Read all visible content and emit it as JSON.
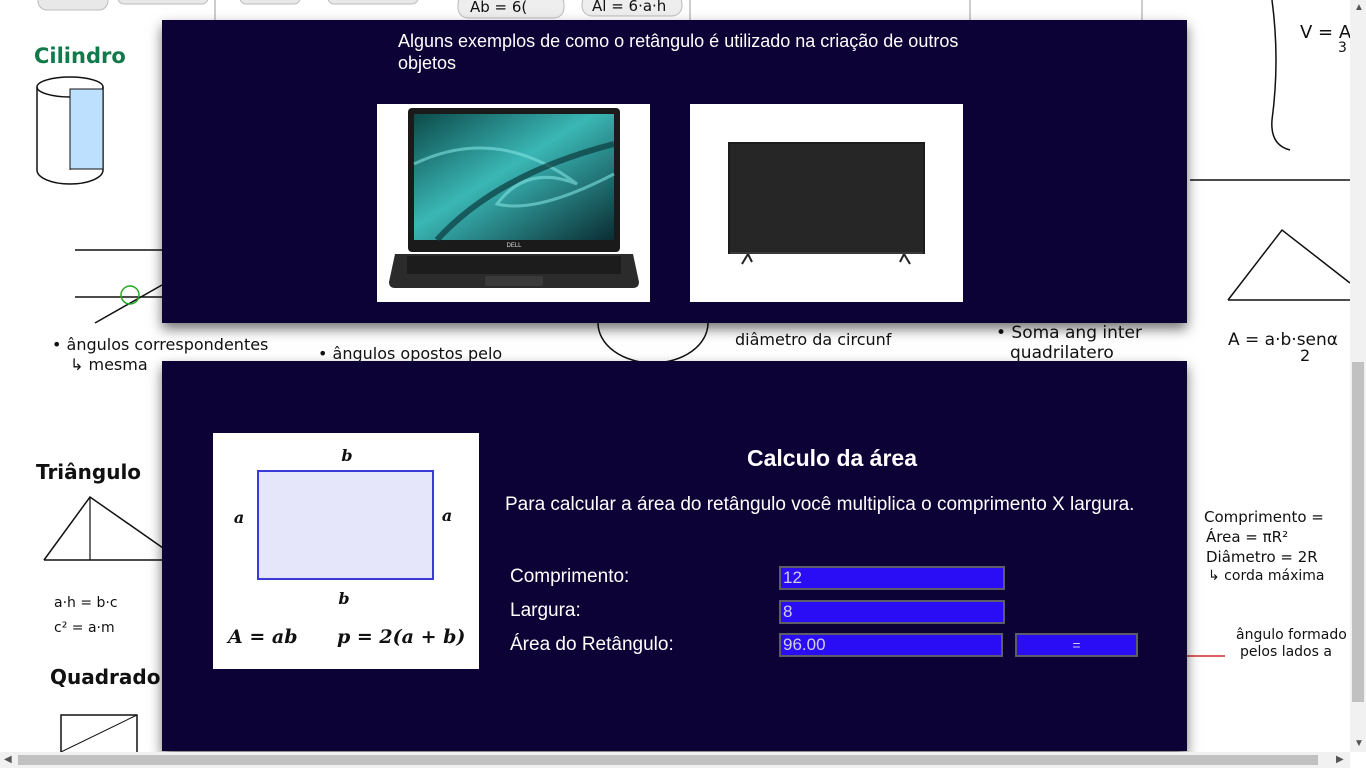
{
  "background": {
    "headings": {
      "cilindro": "Cilindro",
      "triangulo": "Triângulo",
      "quadrado": "Quadrado"
    },
    "notes": {
      "angulos_correspondentes": "• ângulos correspondentes",
      "mesma": "↳ mesma",
      "angulos_opostos": "• ângulos opostos pelo",
      "diametro": "diâmetro da circunf",
      "soma_ang": "• Soma ang inter",
      "quadrilatero": "quadrilatero",
      "area_triangulo": "A = a·b·senα",
      "area_triangulo_den": "2",
      "comprimento": "Comprimento =",
      "area_circ": "Área = πR²",
      "diametro_circ": "Diâmetro = 2R",
      "corda": "↳ corda máxima",
      "angulo_formado": "ângulo formado",
      "pelos_lados": "pelos lados a",
      "relacao_1": "a·h = b·c",
      "relacao_2": "c² = a·m",
      "ab_formula": "Ab = 6(",
      "al_formula": "Al = 6·a·h",
      "v_formula": "V = Ab",
      "v_den": "3"
    }
  },
  "examples_panel": {
    "caption": "Alguns exemplos de como o retângulo é utilizado na criação de outros objetos",
    "laptop_brand": "DELL"
  },
  "area_panel": {
    "figure": {
      "label_top": "b",
      "label_bottom": "b",
      "label_left": "a",
      "label_right": "a",
      "formula_area": "A = ab",
      "formula_perimeter": "p = 2(a + b)"
    },
    "title": "Calculo da área",
    "description": "Para calcular a área do retângulo você multiplica o comprimento X largura.",
    "comprimento_label": "Comprimento:",
    "comprimento_value": "12",
    "largura_label": "Largura:",
    "largura_value": "8",
    "area_label": "Área do Retângulo:",
    "area_value": "96.00",
    "button_label": "="
  },
  "colors": {
    "panel_bg": "#0c0236",
    "field_bg": "#2a0df5",
    "rect_fill": "#e6e6fa",
    "rect_stroke": "#3a3ad8"
  }
}
